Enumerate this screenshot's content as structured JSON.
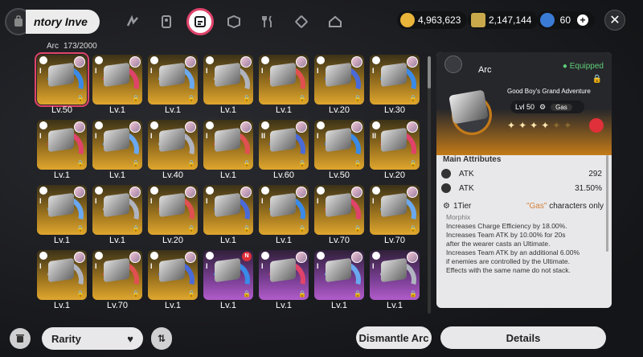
{
  "header": {
    "title": "ntory Inve",
    "nav_tabs": [
      "drive-disc-icon",
      "bangboo-icon",
      "arc-inventory-icon",
      "box-icon",
      "food-icon",
      "cube-icon",
      "home-icon"
    ],
    "currencies": [
      {
        "name": "coin-icon",
        "value": "4,963,623",
        "color": "#e8b43a"
      },
      {
        "name": "ticket-icon",
        "value": "2,147,144",
        "color": "#c8a84a"
      },
      {
        "name": "battery-icon",
        "value": "60",
        "color": "#3a7bd5"
      }
    ],
    "close_label": "✕"
  },
  "inventory": {
    "category": "Arc",
    "count": "173/2000",
    "cards": [
      {
        "level": "Lv.50",
        "tier": "I",
        "rarity": "gold",
        "selected": true
      },
      {
        "level": "Lv.1",
        "tier": "I",
        "rarity": "gold"
      },
      {
        "level": "Lv.1",
        "tier": "I",
        "rarity": "gold"
      },
      {
        "level": "Lv.1",
        "tier": "I",
        "rarity": "gold"
      },
      {
        "level": "Lv.1",
        "tier": "I",
        "rarity": "gold"
      },
      {
        "level": "Lv.20",
        "tier": "I",
        "rarity": "gold"
      },
      {
        "level": "Lv.30",
        "tier": "I",
        "rarity": "gold"
      },
      {
        "level": "Lv.1",
        "tier": "I",
        "rarity": "gold"
      },
      {
        "level": "Lv.1",
        "tier": "I",
        "rarity": "gold"
      },
      {
        "level": "Lv.40",
        "tier": "I",
        "rarity": "gold"
      },
      {
        "level": "Lv.1",
        "tier": "I",
        "rarity": "gold"
      },
      {
        "level": "Lv.60",
        "tier": "II",
        "rarity": "gold"
      },
      {
        "level": "Lv.50",
        "tier": "I",
        "rarity": "gold"
      },
      {
        "level": "Lv.20",
        "tier": "II",
        "rarity": "gold"
      },
      {
        "level": "Lv.1",
        "tier": "I",
        "rarity": "gold"
      },
      {
        "level": "Lv.1",
        "tier": "I",
        "rarity": "gold"
      },
      {
        "level": "Lv.20",
        "tier": "I",
        "rarity": "gold"
      },
      {
        "level": "Lv.1",
        "tier": "I",
        "rarity": "gold"
      },
      {
        "level": "Lv.1",
        "tier": "I",
        "rarity": "gold"
      },
      {
        "level": "Lv.70",
        "tier": "I",
        "rarity": "gold"
      },
      {
        "level": "Lv.70",
        "tier": "I",
        "rarity": "gold"
      },
      {
        "level": "Lv.1",
        "tier": "I",
        "rarity": "gold"
      },
      {
        "level": "Lv.70",
        "tier": "I",
        "rarity": "gold"
      },
      {
        "level": "Lv.1",
        "tier": "I",
        "rarity": "gold"
      },
      {
        "level": "Lv.1",
        "tier": "I",
        "rarity": "purple",
        "new": true
      },
      {
        "level": "Lv.1",
        "tier": "I",
        "rarity": "purple"
      },
      {
        "level": "Lv.1",
        "tier": "I",
        "rarity": "purple"
      },
      {
        "level": "Lv.1",
        "tier": "I",
        "rarity": "purple"
      }
    ],
    "new_badge": "N"
  },
  "detail": {
    "category": "Arc",
    "equipped": "Equipped",
    "name": "Good Boy's Grand Adventure",
    "level": "Lvl 50",
    "attribute": "Gas",
    "stars_on": 4,
    "stars_total": 6,
    "main_attributes_label": "Main Attributes",
    "attributes": [
      {
        "name": "ATK",
        "value": "292"
      },
      {
        "name": "ATK",
        "value": "31.50%"
      }
    ],
    "tier_label": "1Tier",
    "tier_req_q": "\"Gas\"",
    "tier_req_rest": "characters only",
    "effect_name": "Morphix",
    "effect_lines": [
      "Increases Charge Efficiency by 18.00%.",
      "Increases Team ATK by 10.00% for 20s",
      "after the wearer casts an Ultimate.",
      "Increases Team ATK by an additional 6.00%",
      "if enemies are controlled by the Ultimate.",
      "Effects with the same name do not stack."
    ]
  },
  "footer": {
    "rarity_label": "Rarity",
    "dismantle_label": "Dismantle Arc",
    "details_label": "Details"
  },
  "colors": {
    "accent": "#e0436a",
    "gold": "#e0a72e",
    "purple": "#b25ccb",
    "green": "#2aa55a",
    "orange": "#d4803a"
  }
}
